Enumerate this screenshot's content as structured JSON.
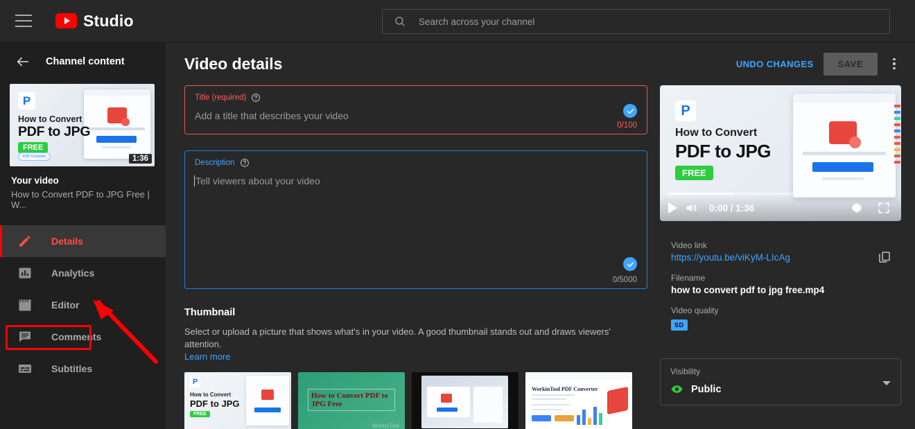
{
  "topbar": {
    "menu_icon": "hamburger-icon",
    "logo_text": "Studio",
    "logo_icon": "youtube-play-icon",
    "search_placeholder": "Search across your channel",
    "search_icon": "search-icon"
  },
  "sidebar": {
    "back_icon": "back-arrow-icon",
    "title": "Channel content",
    "thumbnail": {
      "line1": "How to Convert",
      "line2": "PDF to JPG",
      "badge": "FREE",
      "tag": "PDF Converter",
      "duration": "1:36",
      "logo": "P"
    },
    "video_heading": "Your video",
    "video_title": "How to Convert PDF to JPG Free | W...",
    "items": [
      {
        "label": "Details",
        "icon": "pencil-icon",
        "active": true
      },
      {
        "label": "Analytics",
        "icon": "bar-chart-icon",
        "active": false
      },
      {
        "label": "Editor",
        "icon": "clapperboard-icon",
        "active": false
      },
      {
        "label": "Comments",
        "icon": "comment-bubble-icon",
        "active": false
      },
      {
        "label": "Subtitles",
        "icon": "subtitles-icon",
        "active": false
      }
    ]
  },
  "annotation": {
    "highlight_target": "Editor",
    "color": "#ff0000"
  },
  "main": {
    "title": "Video details",
    "undo_label": "UNDO CHANGES",
    "save_label": "SAVE",
    "more_icon": "kebab-menu-icon",
    "title_field": {
      "label": "Title (required)",
      "help_icon": "help-circle-icon",
      "placeholder": "Add a title that describes your video",
      "value": "",
      "counter": "0/100",
      "status_icon": "check-circle-icon"
    },
    "description_field": {
      "label": "Description",
      "help_icon": "help-circle-icon",
      "placeholder": "Tell viewers about your video",
      "value": "",
      "counter": "0/5000",
      "status_icon": "check-circle-icon"
    },
    "thumbnail_section": {
      "heading": "Thumbnail",
      "description": "Select or upload a picture that shows what's in your video. A good thumbnail stands out and draws viewers' attention.",
      "learn_more": "Learn more",
      "options": [
        {
          "name": "thumbnail-option-1",
          "line1": "How to Convert",
          "line2": "PDF to JPG",
          "badge": "FREE"
        },
        {
          "name": "thumbnail-option-2",
          "text": "How to Convert PDF to JPG Free",
          "watermark": "WorkinTool"
        },
        {
          "name": "thumbnail-option-3",
          "text": ""
        },
        {
          "name": "thumbnail-option-4",
          "text": "WorkinTool PDF Converter"
        }
      ]
    }
  },
  "right_panel": {
    "player": {
      "line1": "How to Convert",
      "line2": "PDF to JPG",
      "badge": "FREE",
      "logo": "P",
      "time": "0:00 / 1:36",
      "play_icon": "play-icon",
      "volume_icon": "volume-icon",
      "settings_icon": "gear-icon",
      "fullscreen_icon": "fullscreen-icon"
    },
    "video_link_label": "Video link",
    "video_link": "https://youtu.be/viKyM-LIcAg",
    "copy_icon": "copy-icon",
    "filename_label": "Filename",
    "filename": "how to convert pdf to jpg free.mp4",
    "quality_label": "Video quality",
    "quality_badge": "SD",
    "visibility_label": "Visibility",
    "visibility_value": "Public",
    "visibility_icon": "eye-icon",
    "visibility_caret": "chevron-down-icon"
  },
  "colors": {
    "accent_red": "#ff0000",
    "link_blue": "#3ea6ff",
    "error_red": "#e05a4f",
    "focus_blue": "#1f7fd6",
    "public_green": "#2ecc40",
    "page_bg": "#1f1f1f",
    "panel_bg": "#282828"
  }
}
